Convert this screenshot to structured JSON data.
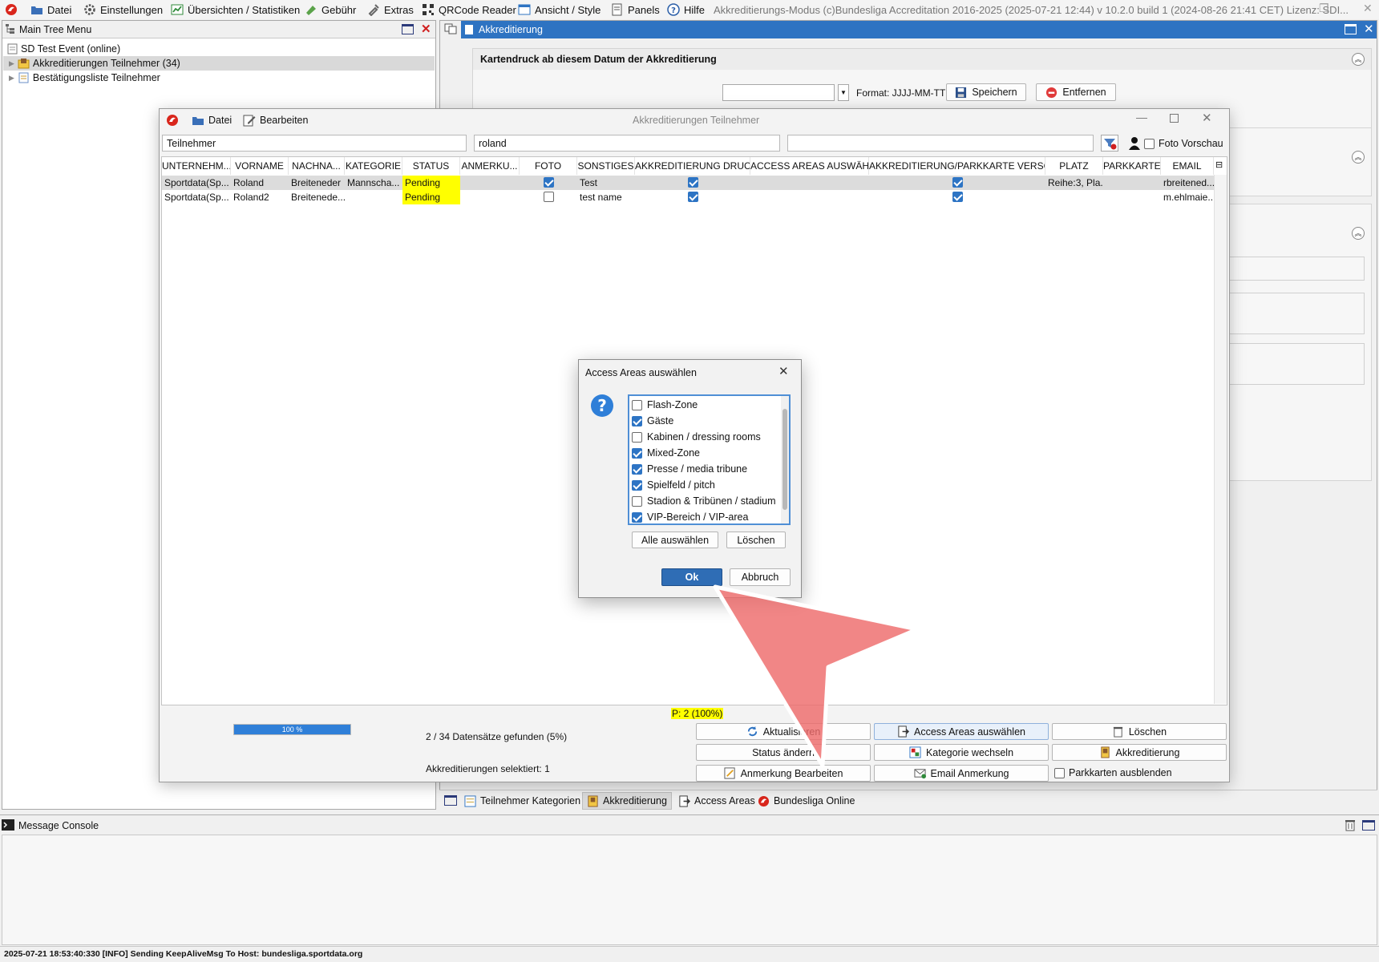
{
  "menubar": {
    "items": [
      "Datei",
      "Einstellungen",
      "Übersichten / Statistiken",
      "Gebühr",
      "Extras",
      "QRCode Reader",
      "Ansicht / Style",
      "Panels",
      "Hilfe"
    ],
    "app_title": "Akkreditierungs-Modus (c)Bundesliga Accreditation 2016-2025 (2025-07-21 12:44) v 10.2.0 build 1 (2024-08-26 21:41 CET) Lizenz: SDI..."
  },
  "tree": {
    "title": "Main Tree Menu",
    "items": [
      "SD Test Event (online)",
      "Akkreditierungen Teilnehmer (34)",
      "Bestätigungsliste Teilnehmer"
    ]
  },
  "right_panel": {
    "title": "Akkreditierung",
    "section_title": "Kartendruck ab diesem Datum der Akkreditierung",
    "date_value": "",
    "format_label": "Format: JJJJ-MM-TT",
    "save_label": "Speichern",
    "remove_label": "Entfernen"
  },
  "inner_window": {
    "title": "Akkreditierungen Teilnehmer",
    "menu": [
      "Datei",
      "Bearbeiten"
    ],
    "filters": [
      "Teilnehmer",
      "roland",
      ""
    ],
    "photo_preview_label": "Foto Vorschau",
    "columns": [
      "UNTERNEHM...",
      "VORNAME",
      "NACHNA...",
      "KATEGORIE",
      "STATUS",
      "ANMERKU...",
      "FOTO",
      "SONSTIGES",
      "AKKREDITIERUNG DRUC...",
      "ACCESS AREAS AUSWÄH...",
      "AKKREDITIERUNG/PARKKARTE VERSCH...",
      "PLATZ",
      "PARKKARTE",
      "EMAIL"
    ],
    "rows": [
      {
        "company": "Sportdata(Sp...",
        "first": "Roland",
        "last": "Breiteneder",
        "category": "Mannscha...",
        "status": "Pending",
        "note": "",
        "photo": true,
        "other": "Test",
        "print": true,
        "areas": "",
        "send": true,
        "place": "Reihe:3, Pla...",
        "parking": "",
        "email": "rbreitened..."
      },
      {
        "company": "Sportdata(Sp...",
        "first": "Roland2",
        "last": "Breitenede...",
        "category": "",
        "status": "Pending",
        "note": "",
        "photo": false,
        "other": "test name",
        "print": true,
        "areas": "",
        "send": true,
        "place": "",
        "parking": "",
        "email": "m.ehlmaie..."
      }
    ],
    "pager": "P: 2 (100%)",
    "progress_text": "100 %",
    "progress_fraction": 1.0,
    "found_text": "2 / 34 Datensätze gefunden (5%)",
    "selected_text": "Akkreditierungen selektiert: 1",
    "buttons": {
      "refresh": "Aktualisieren",
      "access_areas": "Access Areas auswählen",
      "delete": "Löschen",
      "status": "Status ändern",
      "category": "Kategorie wechseln",
      "accreditation": "Akkreditierung",
      "edit_note": "Anmerkung Bearbeiten",
      "email_note": "Email Anmerkung",
      "hide_parking": "Parkkarten ausblenden"
    }
  },
  "bottom_tabs": [
    "Teilnehmer Kategorien",
    "Akkreditierung",
    "Access Areas",
    "Bundesliga Online"
  ],
  "console": {
    "title": "Message Console"
  },
  "statusbar": {
    "text": "2025-07-21 18:53:40:330 [INFO] Sending KeepAliveMsg To Host: bundesliga.sportdata.org"
  },
  "dialog": {
    "title": "Access Areas auswählen",
    "areas": [
      {
        "label": "Flash-Zone",
        "checked": false
      },
      {
        "label": "Gäste",
        "checked": true
      },
      {
        "label": "Kabinen / dressing rooms",
        "checked": false
      },
      {
        "label": "Mixed-Zone",
        "checked": true
      },
      {
        "label": "Presse / media tribune",
        "checked": true
      },
      {
        "label": "Spielfeld / pitch",
        "checked": true
      },
      {
        "label": "Stadion & Tribünen / stadium",
        "checked": false
      },
      {
        "label": "VIP-Bereich / VIP-area",
        "checked": true
      }
    ],
    "select_all": "Alle auswählen",
    "clear": "Löschen",
    "ok": "Ok",
    "cancel": "Abbruch"
  },
  "colors": {
    "accent": "#2e73c2",
    "status_highlight": "#ffff00",
    "arrow": "#ee6b6b",
    "ok_button": "#2f6db5"
  }
}
